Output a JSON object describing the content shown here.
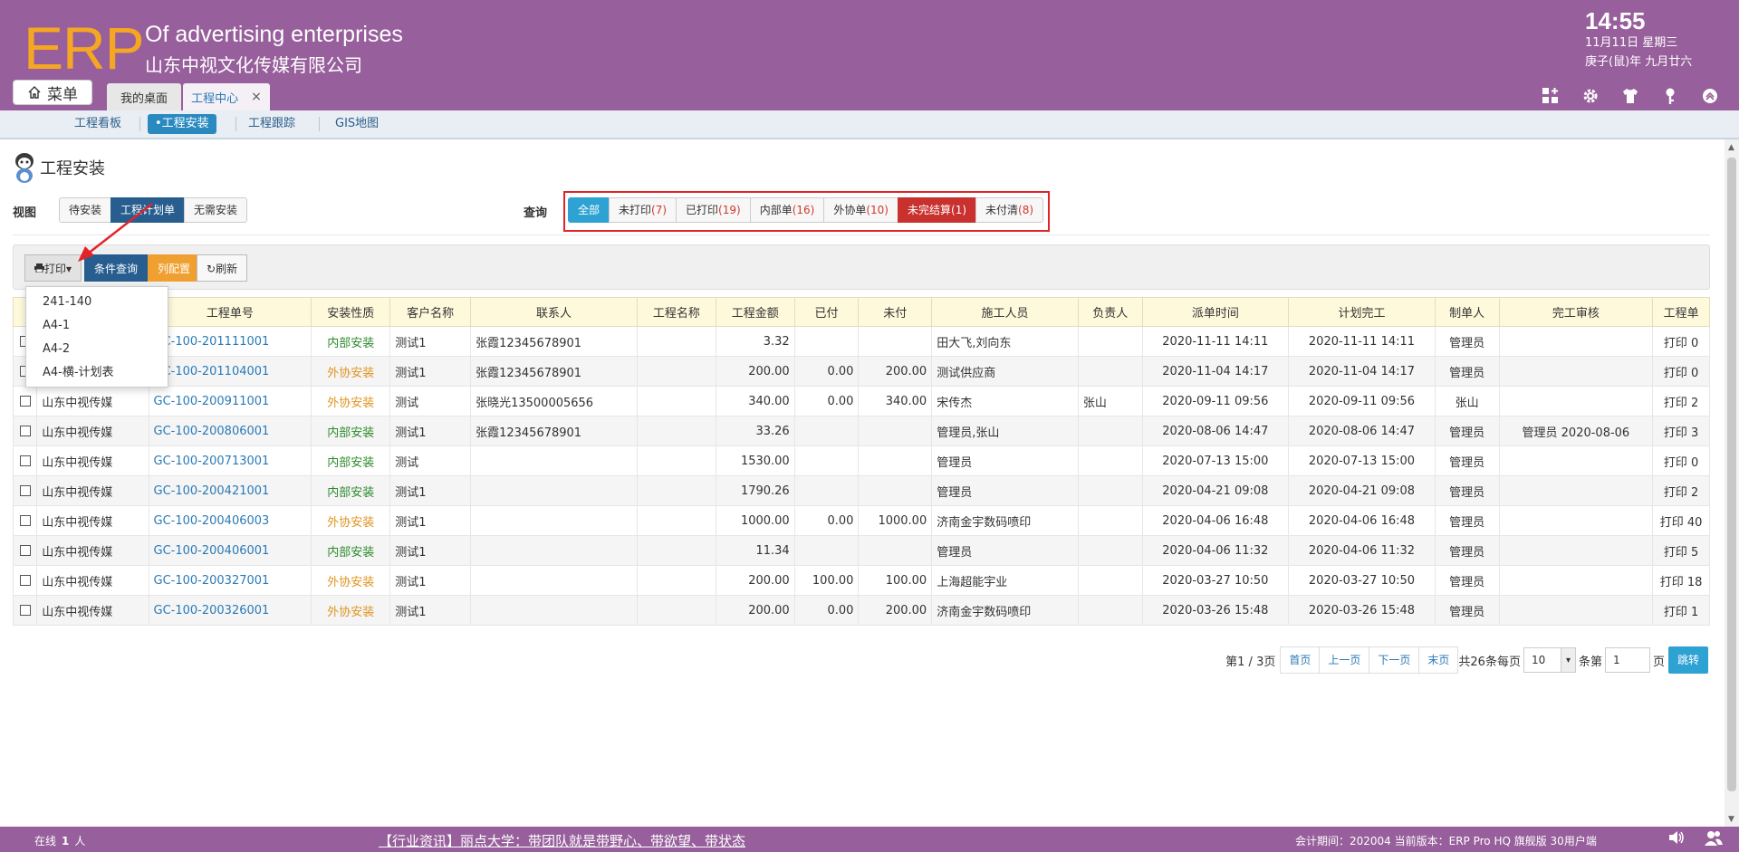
{
  "header": {
    "logo": "ERP",
    "company_en": "Of advertising enterprises",
    "company_cn": "山东中视文化传媒有限公司",
    "time": "14:55",
    "date": "11月11日 星期三",
    "lunar": "庚子(鼠)年 九月廿六",
    "menu_label": "菜单",
    "tabs": [
      {
        "label": "我的桌面"
      },
      {
        "label": "工程中心",
        "close": "×"
      }
    ]
  },
  "subnav": {
    "items": [
      "工程看板",
      "•工程安装",
      "工程跟踪",
      "GIS地图"
    ]
  },
  "page": {
    "title": "工程安装"
  },
  "view": {
    "label": "视图",
    "buttons": [
      "待安装",
      "工程计划单",
      "无需安装"
    ]
  },
  "query": {
    "label": "查询",
    "filters": [
      {
        "label": "全部",
        "count": ""
      },
      {
        "label": "未打印",
        "count": "(7)"
      },
      {
        "label": "已打印",
        "count": "(19)"
      },
      {
        "label": "内部单",
        "count": "(16)"
      },
      {
        "label": "外协单",
        "count": "(10)"
      },
      {
        "label": "未完结算",
        "count": "(1)"
      },
      {
        "label": "未付清",
        "count": "(8)"
      }
    ]
  },
  "toolbar": {
    "print": "打印",
    "condition": "条件查询",
    "columns": "列配置",
    "refresh": "刷新"
  },
  "print_menu": [
    "241-140",
    "A4-1",
    "A4-2",
    "A4-横-计划表"
  ],
  "table": {
    "headers": [
      "",
      "",
      "工程单号",
      "安装性质",
      "客户名称",
      "联系人",
      "工程名称",
      "工程金额",
      "已付",
      "未付",
      "施工人员",
      "负责人",
      "派单时间",
      "计划完工",
      "制单人",
      "完工审核",
      "工程单"
    ],
    "rows": [
      [
        "",
        "",
        "GC-100-201111001",
        "内部安装",
        "测试1",
        "张霞12345678901",
        "",
        "3.32",
        "",
        "",
        "田大飞,刘向东",
        "",
        "2020-11-11 14:11",
        "2020-11-11 14:11",
        "管理员",
        "",
        "打印 0"
      ],
      [
        "",
        "",
        "GC-100-201104001",
        "外协安装",
        "测试1",
        "张霞12345678901",
        "",
        "200.00",
        "0.00",
        "200.00",
        "测试供应商",
        "",
        "2020-11-04 14:17",
        "2020-11-04 14:17",
        "管理员",
        "",
        "打印 0"
      ],
      [
        "",
        "山东中视传媒",
        "GC-100-200911001",
        "外协安装",
        "测试",
        "张晓光13500005656",
        "",
        "340.00",
        "0.00",
        "340.00",
        "宋传杰",
        "张山",
        "2020-09-11 09:56",
        "2020-09-11 09:56",
        "张山",
        "",
        "打印 2"
      ],
      [
        "",
        "山东中视传媒",
        "GC-100-200806001",
        "内部安装",
        "测试1",
        "张霞12345678901",
        "",
        "33.26",
        "",
        "",
        "管理员,张山",
        "",
        "2020-08-06 14:47",
        "2020-08-06 14:47",
        "管理员",
        "管理员 2020-08-06",
        "打印 3"
      ],
      [
        "",
        "山东中视传媒",
        "GC-100-200713001",
        "内部安装",
        "测试",
        "",
        "",
        "1530.00",
        "",
        "",
        "管理员",
        "",
        "2020-07-13 15:00",
        "2020-07-13 15:00",
        "管理员",
        "",
        "打印 0"
      ],
      [
        "",
        "山东中视传媒",
        "GC-100-200421001",
        "内部安装",
        "测试1",
        "",
        "",
        "1790.26",
        "",
        "",
        "管理员",
        "",
        "2020-04-21 09:08",
        "2020-04-21 09:08",
        "管理员",
        "",
        "打印 2"
      ],
      [
        "",
        "山东中视传媒",
        "GC-100-200406003",
        "外协安装",
        "测试1",
        "",
        "",
        "1000.00",
        "0.00",
        "1000.00",
        "济南金宇数码喷印",
        "",
        "2020-04-06 16:48",
        "2020-04-06 16:48",
        "管理员",
        "",
        "打印 40"
      ],
      [
        "",
        "山东中视传媒",
        "GC-100-200406001",
        "内部安装",
        "测试1",
        "",
        "",
        "11.34",
        "",
        "",
        "管理员",
        "",
        "2020-04-06 11:32",
        "2020-04-06 11:32",
        "管理员",
        "",
        "打印 5"
      ],
      [
        "",
        "山东中视传媒",
        "GC-100-200327001",
        "外协安装",
        "测试1",
        "",
        "",
        "200.00",
        "100.00",
        "100.00",
        "上海超能宇业",
        "",
        "2020-03-27 10:50",
        "2020-03-27 10:50",
        "管理员",
        "",
        "打印 18"
      ],
      [
        "",
        "山东中视传媒",
        "GC-100-200326001",
        "外协安装",
        "测试1",
        "",
        "",
        "200.00",
        "0.00",
        "200.00",
        "济南金宇数码喷印",
        "",
        "2020-03-26 15:48",
        "2020-03-26 15:48",
        "管理员",
        "",
        "打印 1"
      ]
    ]
  },
  "pager": {
    "page_info": "第1 / 3页",
    "first": "首页",
    "prev": "上一页",
    "next": "下一页",
    "last": "末页",
    "total": "共26条每页",
    "page_size": "10",
    "goto_prefix": "条第",
    "goto_value": "1",
    "goto_suffix": "页",
    "jump": "跳转"
  },
  "footer": {
    "online_label": "在线",
    "online_count": "1",
    "online_unit": "人",
    "news": "【行业资讯】丽点大学：带团队就是带野心、带欲望、带状态",
    "accounting": "会计期间：202004 当前版本：ERP Pro HQ 旗舰版 30用户端"
  },
  "colors": {
    "header_bg": "#975f9b",
    "logo": "#f5a623",
    "accent_blue": "#2ea2d3",
    "dark_blue": "#275d8f",
    "red": "#c8312e",
    "internal_green": "#2c8a2c",
    "external_orange": "#e09420"
  }
}
